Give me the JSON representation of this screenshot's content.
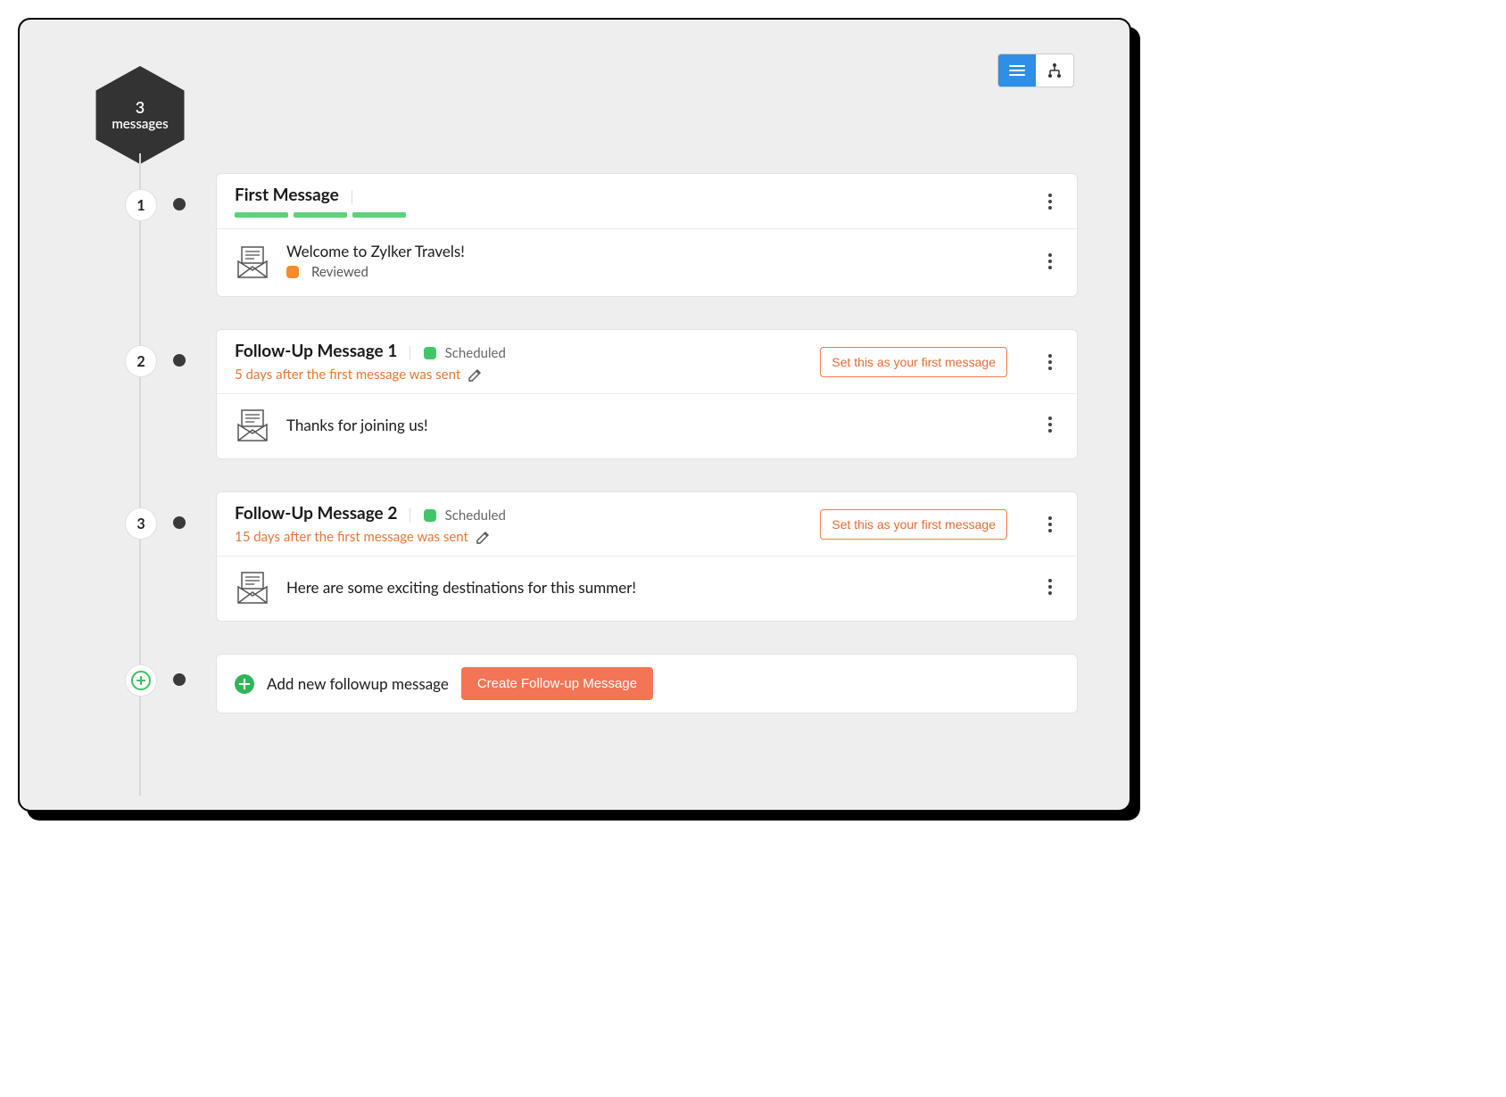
{
  "header": {
    "count": "3",
    "count_label": "messages"
  },
  "view_toggle": {
    "list_active": true
  },
  "messages": [
    {
      "index": "1",
      "title": "First Message",
      "status_label": "",
      "show_bars": true,
      "schedule_text": "",
      "set_first_label": "",
      "content_title": "Welcome to Zylker Travels!",
      "content_status": "Reviewed",
      "content_status_color": "orange"
    },
    {
      "index": "2",
      "title": "Follow-Up Message 1",
      "status_label": "Scheduled",
      "show_bars": false,
      "schedule_text": "5 days after the first message was sent",
      "set_first_label": "Set this as your first message",
      "content_title": "Thanks for joining us!",
      "content_status": "",
      "content_status_color": ""
    },
    {
      "index": "3",
      "title": "Follow-Up Message 2",
      "status_label": "Scheduled",
      "show_bars": false,
      "schedule_text": "15 days after the first message was sent",
      "set_first_label": "Set this as your first message",
      "content_title": "Here are some exciting destinations for this summer!",
      "content_status": "",
      "content_status_color": ""
    }
  ],
  "add_row": {
    "text": "Add new followup message",
    "button": "Create Follow-up Message"
  }
}
